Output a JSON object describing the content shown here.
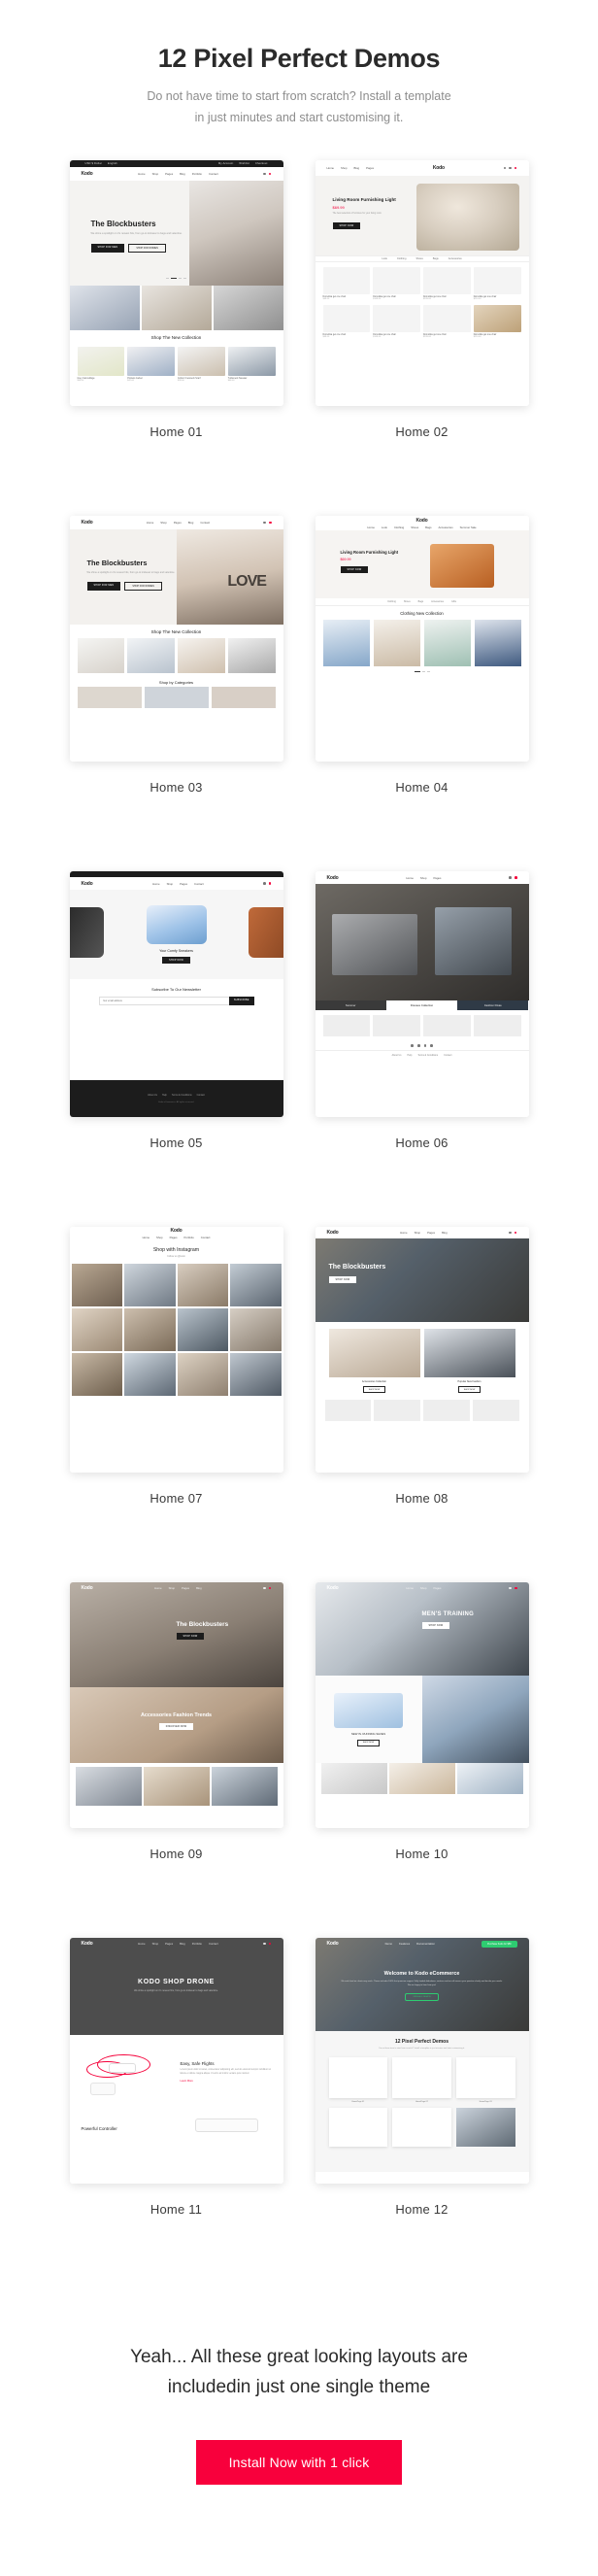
{
  "hero": {
    "title": "12 Pixel Perfect Demos",
    "subtitle_line1": "Do not have time to start from scratch? Install a template",
    "subtitle_line2": "in just minutes and start customising it."
  },
  "brand": {
    "logo": "Kodo",
    "accent_color": "#f8003c",
    "dark_color": "#1c1c1c"
  },
  "topbar": {
    "left": "USD  $ Dollar",
    "left2": "English",
    "right1": "My Account",
    "right2": "Wishlist",
    "right3": "Checkout"
  },
  "nav": {
    "items": [
      "Home",
      "Shop",
      "Pages",
      "Blog",
      "Portfolio",
      "Contact"
    ],
    "items_alt": [
      "Home",
      "Look",
      "Clothing",
      "Shoes",
      "Bags",
      "Accessories",
      "Gifts",
      "Summer Sale",
      "Hot Sale"
    ],
    "items_landing": [
      "Demo",
      "Features",
      "Documentation"
    ]
  },
  "demos": [
    {
      "id": "home-01",
      "label": "Home 01",
      "hero_title": "The Blockbusters",
      "hero_sub": "We shine a spotlight on it's newest hits, from go-to knitwear to bags and valentine.",
      "btn_primary": "SHOP FOR MEN",
      "btn_secondary": "SHOP FOR WOMEN",
      "section_title": "Shop The New Collection",
      "products": [
        {
          "name": "Grey Camouflage",
          "price": "$55.00"
        },
        {
          "name": "Pockets Jacket",
          "price": "$42.00"
        },
        {
          "name": "Cotton Crewneck Scarf",
          "price": "$39.00"
        },
        {
          "name": "Turtleneck Sweater",
          "price": "$68.00"
        }
      ]
    },
    {
      "id": "home-02",
      "label": "Home 02",
      "hero_title": "Living Room Furnishing Light",
      "hero_price": "$69.99",
      "hero_sub": "The best selection of furniture for your living room",
      "btn_primary": "SHOP NOW",
      "products": [
        {
          "name": "Domotika get one chair",
          "price": "$49.00"
        },
        {
          "name": "Domotika get one chair",
          "price": "$149.00"
        },
        {
          "name": "Domotika get one chair",
          "price": "$199.00"
        },
        {
          "name": "Domotika get one chair",
          "price": "$110.00"
        }
      ]
    },
    {
      "id": "home-03",
      "label": "Home 03",
      "hero_title": "The Blockbusters",
      "hero_sub": "We shine a spotlight on it's newest hits, from go-to knitwear to bags and valentine.",
      "btn_primary": "SHOP FOR MEN",
      "btn_secondary": "SHOP FOR WOMEN",
      "section_title": "Shop The New Collection",
      "section_title2": "Shop by Categories",
      "overlay_word": "LOVE"
    },
    {
      "id": "home-04",
      "label": "Home 04",
      "hero_title": "Living Room Furnishing Light",
      "hero_price": "$69.99",
      "btn_primary": "SHOP NOW",
      "section_title": "Clothing New Collection"
    },
    {
      "id": "home-05",
      "label": "Home 05",
      "hero_title": "Your Comfy Sneakers",
      "newsletter_title": "Subscribe To Our Newsletter",
      "newsletter_placeholder": "Your email address",
      "newsletter_btn": "SUBSCRIBE",
      "footer_note": "Kodo eCommerce. All rights reserved."
    },
    {
      "id": "home-06",
      "label": "Home 06",
      "cat1": "Summer",
      "cat2": "Dresses Collection",
      "cat3": "Fashion Divas",
      "footer_links": [
        "About Us",
        "Help",
        "Terms & Conditions",
        "Contact"
      ]
    },
    {
      "id": "home-07",
      "label": "Home 07",
      "section_title": "Shop with Instagram",
      "section_sub": "Follow us @kodo"
    },
    {
      "id": "home-08",
      "label": "Home 08",
      "hero_title": "The Blockbusters",
      "btn_primary": "SHOP NOW",
      "cat1": "Accessories Collection",
      "cat2": "Popular New Fashion",
      "btn_secondary": "SHOP NOW"
    },
    {
      "id": "home-09",
      "label": "Home 09",
      "hero_title": "The Blockbusters",
      "btn_primary": "SHOP NOW",
      "banner_title": "Accessories Fashion Trends",
      "btn_secondary": "DISCOVER NOW"
    },
    {
      "id": "home-10",
      "label": "Home 10",
      "hero_title": "MEN'S TRAINING",
      "btn_primary": "SHOP NOW",
      "sub_title": "NEW IN. RUNNING SHOES"
    },
    {
      "id": "home-11",
      "label": "Home 11",
      "hero_title": "KODO SHOP DRONE",
      "hero_sub": "We shine a spotlight on it's newest hits, from go-to knitwear to bags and valentine.",
      "feature1_title": "Easy, Safe Flights",
      "feature1_sub": "Lorem ipsum dolor sit amet, consectetur adipiscing elit, sed do eiusmod tempor incididunt ut labore et dolore magna aliqua. Ut enim ad minim veniam quis nostrud.",
      "feature1_link": "Learn More",
      "feature2_title": "Powerful Controller"
    },
    {
      "id": "home-12",
      "label": "Home 12",
      "hero_title": "Welcome to Kodo eCommerce",
      "hero_sub": "We work hard on clients very much. Theme includes 100% fast premium support. Fully loaded slideshows, sections and we will answer your question shortly and decide your needs. We are happy to hear from you!",
      "btn_primary": "VIEW ALL DEMOS",
      "btn_header": "Purchase Kodo for $59",
      "inner_section_title": "12 Pixel Perfect Demos",
      "inner_section_sub": "Do not have time to start from scratch? Install a template in just minutes and start customising it.",
      "inner_labels": [
        "HomePage 01",
        "HomePage 02",
        "HomePage 03"
      ]
    }
  ],
  "cta": {
    "title_line1": "Yeah... All these great looking layouts are",
    "title_line2": "includedin just one single theme",
    "button_label": "Install Now with 1 click"
  }
}
